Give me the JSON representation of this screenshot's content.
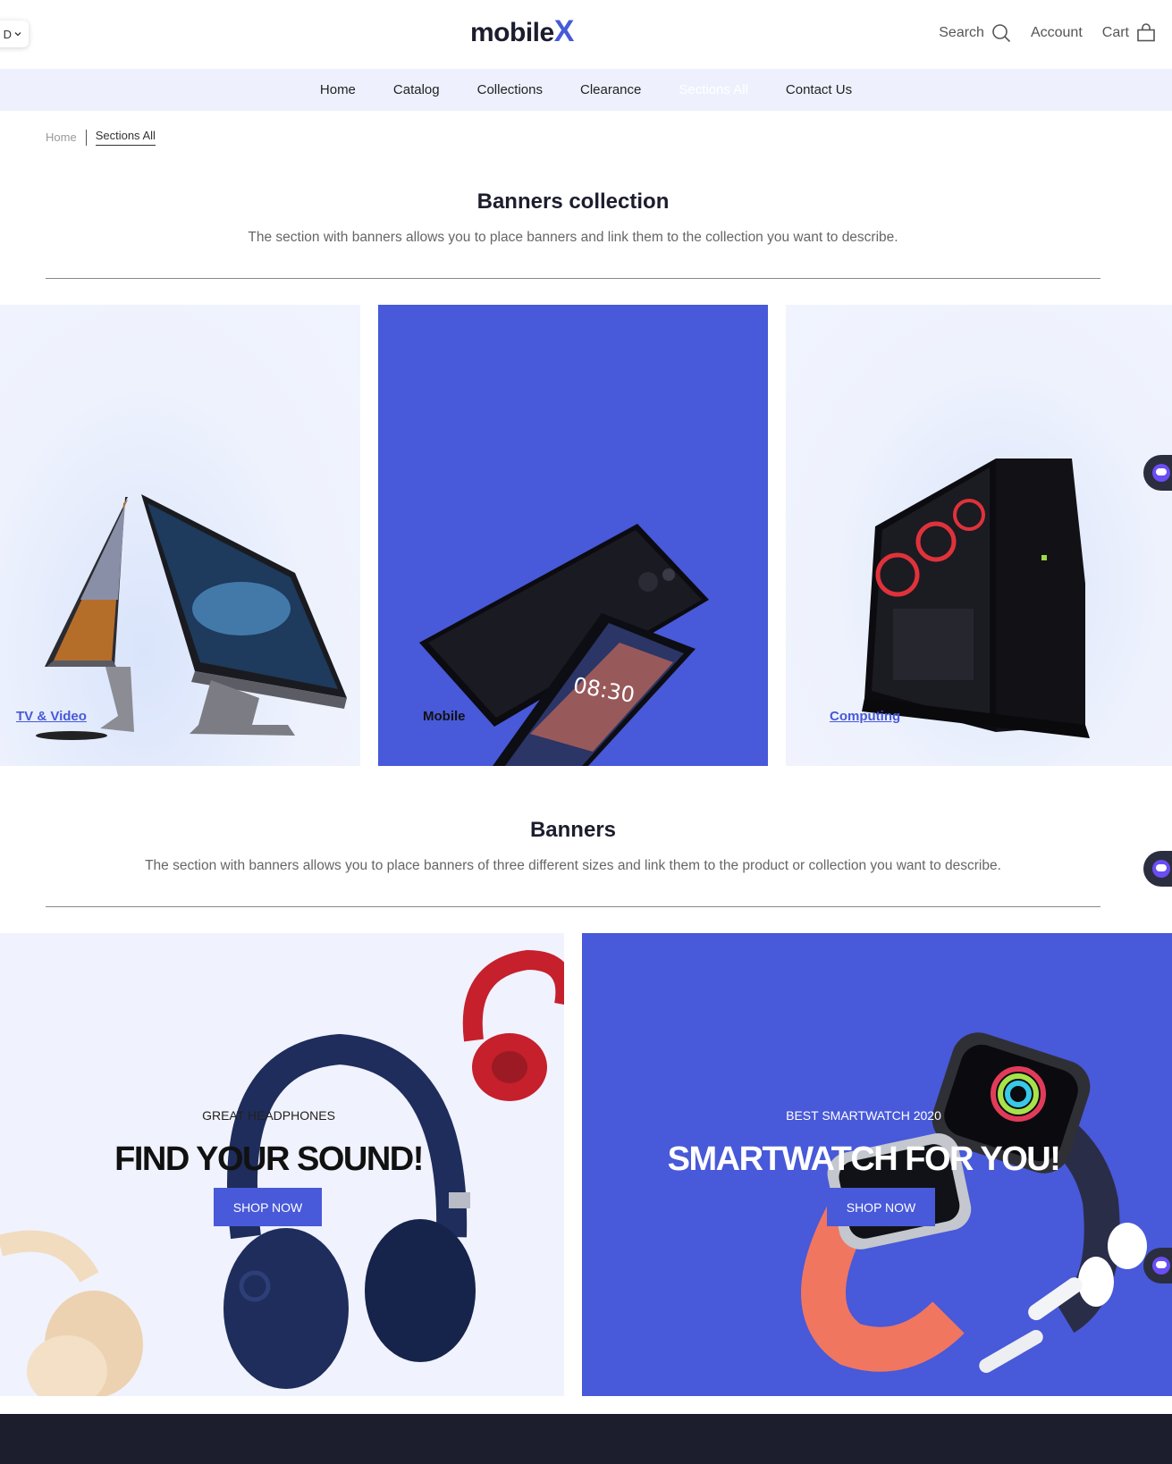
{
  "header": {
    "currency": "D",
    "logo_main": "mobile",
    "logo_x": "X",
    "search_label": "Search",
    "account_label": "Account",
    "cart_label": "Cart"
  },
  "nav": {
    "items": [
      "Home",
      "Catalog",
      "Collections",
      "Clearance",
      "Sections All",
      "Contact Us"
    ],
    "active": "Sections All"
  },
  "breadcrumb": {
    "home": "Home",
    "current": "Sections All"
  },
  "collections_section": {
    "title": "Banners collection",
    "description": "The section with banners allows you to place banners and link them to the collection you want to describe.",
    "banners": [
      {
        "label": "TV & Video"
      },
      {
        "label": "Mobile"
      },
      {
        "label": "Computing"
      }
    ]
  },
  "banners_section": {
    "title": "Banners",
    "description": "The section with banners allows you to place banners of three different sizes and link them to the product or collection you want to describe.",
    "promo": [
      {
        "subtitle": "GREAT HEADPHONES",
        "title": "FIND YOUR SOUND!",
        "button": "SHOP NOW"
      },
      {
        "subtitle": "BEST SMARTWATCH 2020",
        "title": "SMARTWATCH FOR YOU!",
        "button": "SHOP NOW"
      }
    ]
  },
  "phone_screen_time": "08:30",
  "colors": {
    "accent": "#4859d9",
    "nav_bg": "#eef1fd",
    "banner_light": "#f0f2fd",
    "dark": "#1c1d2d",
    "headphone_blue": "#1e2d5c",
    "headphone_red": "#c5202c",
    "watch_band": "#f07660"
  },
  "icons": [
    "chevron-down-icon",
    "search-icon",
    "cart-bag-icon",
    "chat-widget-icon"
  ]
}
